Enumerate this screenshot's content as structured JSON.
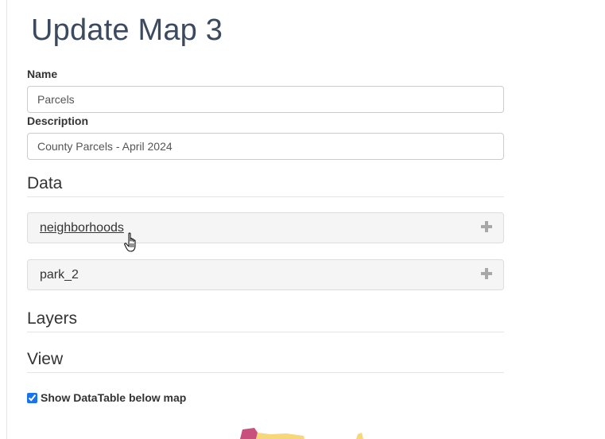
{
  "page": {
    "title": "Update Map 3"
  },
  "form": {
    "name_label": "Name",
    "name_value": "Parcels",
    "description_label": "Description",
    "description_value": "County Parcels - April 2024"
  },
  "sections": {
    "data": "Data",
    "layers": "Layers",
    "view": "View"
  },
  "data_items": [
    {
      "label": "neighborhoods"
    },
    {
      "label": "park_2"
    }
  ],
  "view": {
    "show_datatable_label": "Show DataTable below map",
    "show_datatable_checked": true
  },
  "colors": {
    "title": "#3b4a5e",
    "panel_bg": "#f5f5f5",
    "checkbox_accent": "#1a73e8",
    "map_pink": "#c94f7c",
    "map_yellow": "#f6d77a"
  },
  "icons": {
    "expand": "plus-icon",
    "cursor": "hand-pointer-icon"
  }
}
